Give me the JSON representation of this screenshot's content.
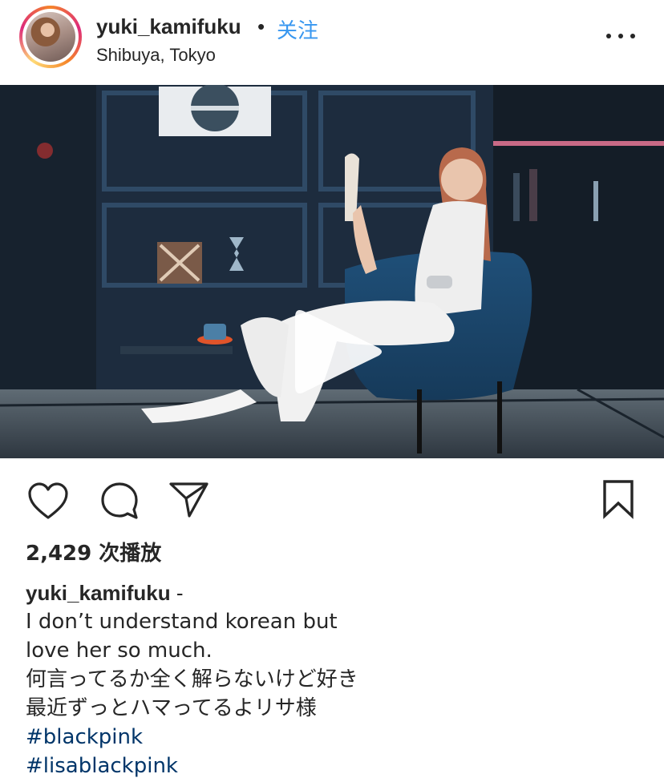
{
  "header": {
    "username": "yuki_kamifuku",
    "separator": "•",
    "follow_label": "关注",
    "location": "Shibuya, Tokyo",
    "more_icon": "more-horizontal-icon"
  },
  "media": {
    "type": "video",
    "play_icon": "play-icon"
  },
  "actions": {
    "like_icon": "heart-icon",
    "comment_icon": "comment-icon",
    "share_icon": "paper-plane-icon",
    "save_icon": "bookmark-icon"
  },
  "stats": {
    "views": "2,429 次播放"
  },
  "caption": {
    "author": "yuki_kamifuku",
    "author_suffix": " -",
    "lines": [
      "I don’t understand korean but",
      "love her so much.",
      "何言ってるか全く解らないけど好き",
      "最近ずっとハマってるよリサ様"
    ],
    "hashtags": [
      "#blackpink",
      "#lisablackpink"
    ]
  },
  "colors": {
    "link_blue": "#3897f0",
    "hashtag": "#003569",
    "text": "#262626"
  }
}
